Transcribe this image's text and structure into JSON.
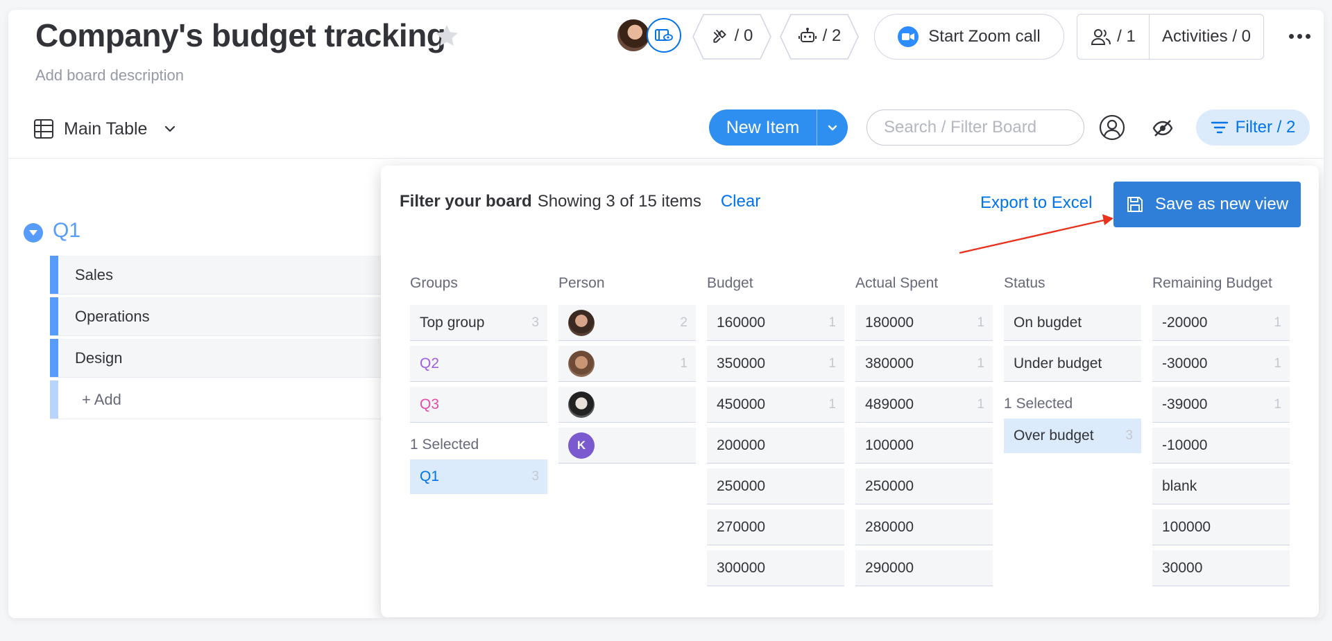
{
  "board": {
    "title": "Company's budget tracking",
    "description": "Add board description"
  },
  "header": {
    "integrations_count": "/ 0",
    "automations_count": "/ 2",
    "zoom_label": "Start Zoom call",
    "members_count": "/ 1",
    "activities_label": "Activities / 0"
  },
  "toolbar": {
    "view_label": "Main Table",
    "new_item_label": "New Item",
    "search_placeholder": "Search / Filter Board",
    "filter_label": "Filter / 2"
  },
  "group": {
    "title": "Q1",
    "items": [
      "Sales",
      "Operations",
      "Design"
    ],
    "add_label": "+ Add"
  },
  "filter_panel": {
    "title": "Filter your board",
    "showing": "Showing 3 of 15 items",
    "clear_label": "Clear",
    "export_label": "Export to Excel",
    "save_label": "Save as new view",
    "groups": {
      "header": "Groups",
      "options": [
        {
          "label": "Top group",
          "count": "3",
          "color": "#323338"
        },
        {
          "label": "Q2",
          "count": "",
          "color": "#a25ddc"
        },
        {
          "label": "Q3",
          "count": "",
          "color": "#e44bb0"
        }
      ],
      "selected_label": "1 Selected",
      "selected": {
        "label": "Q1",
        "count": "3"
      }
    },
    "person": {
      "header": "Person",
      "options": [
        {
          "avatar": "avatar-woman-1",
          "count": "2"
        },
        {
          "avatar": "avatar-woman-2",
          "count": "1"
        },
        {
          "avatar": "avatar-woman-3",
          "count": ""
        },
        {
          "avatar": "avatar-initial",
          "initial": "K",
          "count": ""
        }
      ]
    },
    "budget": {
      "header": "Budget",
      "options": [
        {
          "label": "160000",
          "count": "1"
        },
        {
          "label": "350000",
          "count": "1"
        },
        {
          "label": "450000",
          "count": "1"
        },
        {
          "label": "200000",
          "count": ""
        },
        {
          "label": "250000",
          "count": ""
        },
        {
          "label": "270000",
          "count": ""
        },
        {
          "label": "300000",
          "count": ""
        }
      ]
    },
    "actual_spent": {
      "header": "Actual Spent",
      "options": [
        {
          "label": "180000",
          "count": "1"
        },
        {
          "label": "380000",
          "count": "1"
        },
        {
          "label": "489000",
          "count": "1"
        },
        {
          "label": "100000",
          "count": ""
        },
        {
          "label": "250000",
          "count": ""
        },
        {
          "label": "280000",
          "count": ""
        },
        {
          "label": "290000",
          "count": ""
        }
      ]
    },
    "status": {
      "header": "Status",
      "options": [
        {
          "label": "On bugdet",
          "count": ""
        },
        {
          "label": "Under budget",
          "count": ""
        }
      ],
      "selected_label": "1 Selected",
      "selected": {
        "label": "Over budget",
        "count": "3"
      }
    },
    "remaining_budget": {
      "header": "Remaining Budget",
      "options": [
        {
          "label": "-20000",
          "count": "1"
        },
        {
          "label": "-30000",
          "count": "1"
        },
        {
          "label": "-39000",
          "count": "1"
        },
        {
          "label": "-10000",
          "count": ""
        },
        {
          "label": "blank",
          "count": ""
        },
        {
          "label": "100000",
          "count": ""
        },
        {
          "label": "30000",
          "count": ""
        }
      ]
    }
  }
}
